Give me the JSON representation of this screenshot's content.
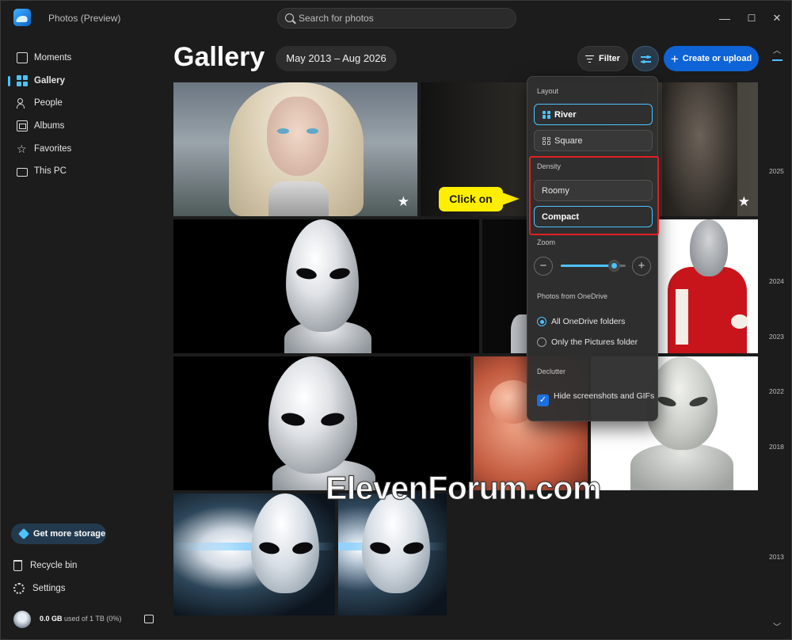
{
  "app": {
    "title": "Photos (Preview)"
  },
  "search": {
    "placeholder": "Search for photos"
  },
  "window_controls": {
    "minimize": "—",
    "maximize": "☐",
    "close": "✕"
  },
  "sidebar": {
    "items": [
      {
        "label": "Moments",
        "icon": "moments-icon"
      },
      {
        "label": "Gallery",
        "icon": "gallery-icon",
        "active": true
      },
      {
        "label": "People",
        "icon": "people-icon"
      },
      {
        "label": "Albums",
        "icon": "albums-icon"
      },
      {
        "label": "Favorites",
        "icon": "star-icon"
      },
      {
        "label": "This PC",
        "icon": "folder-icon"
      }
    ],
    "storage_button": "Get more storage",
    "recycle_bin": "Recycle bin",
    "settings": "Settings",
    "storage_used": "0.0 GB",
    "storage_detail": "used of 1 TB (0%)"
  },
  "header": {
    "title": "Gallery",
    "date_range": "May 2013 – Aug 2026",
    "filter_label": "Filter",
    "create_label": "Create or upload"
  },
  "timeline": {
    "years": [
      "2025",
      "2024",
      "2023",
      "2022",
      "2018",
      "2013"
    ]
  },
  "flyout": {
    "layout_heading": "Layout",
    "layout_options": [
      "River",
      "Square"
    ],
    "layout_selected": "River",
    "density_heading": "Density",
    "density_options": [
      "Roomy",
      "Compact"
    ],
    "density_selected": "Compact",
    "zoom_heading": "Zoom",
    "zoom_level": 0.82,
    "onedrive_heading": "Photos from OneDrive",
    "onedrive_options": [
      "All OneDrive folders",
      "Only the Pictures folder"
    ],
    "onedrive_selected": "All OneDrive folders",
    "declutter_heading": "Declutter",
    "declutter_option": "Hide screenshots and GIFs",
    "declutter_checked": true
  },
  "callout": {
    "text": "Click on"
  },
  "watermark": {
    "text": "ElevenForum.com"
  },
  "colors": {
    "accent": "#4cc2ff",
    "primary_button": "#0e64d6",
    "callout": "#ffee00",
    "highlight_box": "#e02020"
  }
}
